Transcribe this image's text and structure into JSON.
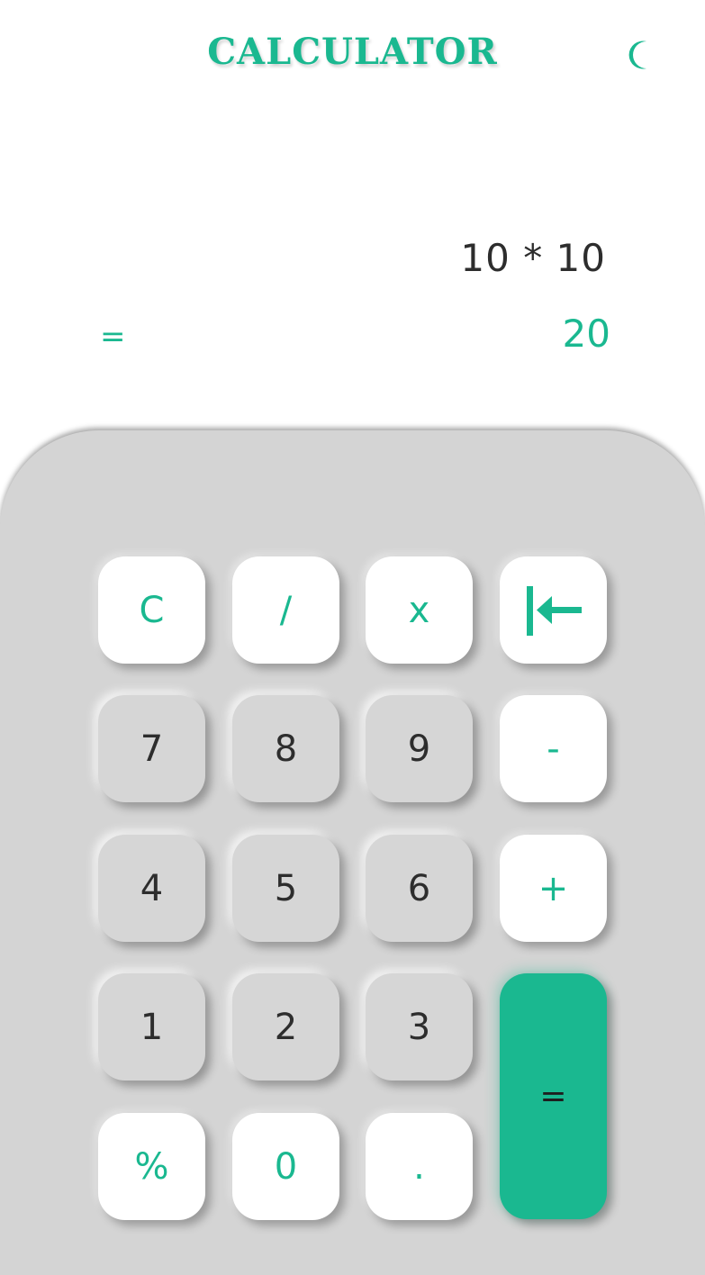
{
  "header": {
    "title": "CALCULATOR",
    "theme_toggle_icon": "moon-icon"
  },
  "display": {
    "expression": "10 * 10",
    "equals_symbol": "=",
    "result": "20"
  },
  "keypad": {
    "clear": "C",
    "divide": "/",
    "multiply": "x",
    "backspace_icon": "backspace-arrow-icon",
    "seven": "7",
    "eight": "8",
    "nine": "9",
    "subtract": "-",
    "four": "4",
    "five": "5",
    "six": "6",
    "add": "+",
    "one": "1",
    "two": "2",
    "three": "3",
    "equals": "=",
    "percent": "%",
    "zero": "0",
    "decimal": "."
  },
  "colors": {
    "accent": "#1ab890",
    "keypad_background": "#d4d4d4",
    "digit_key": "#d6d6d6",
    "operator_key": "#ffffff",
    "text_dark": "#2d2d2d"
  }
}
